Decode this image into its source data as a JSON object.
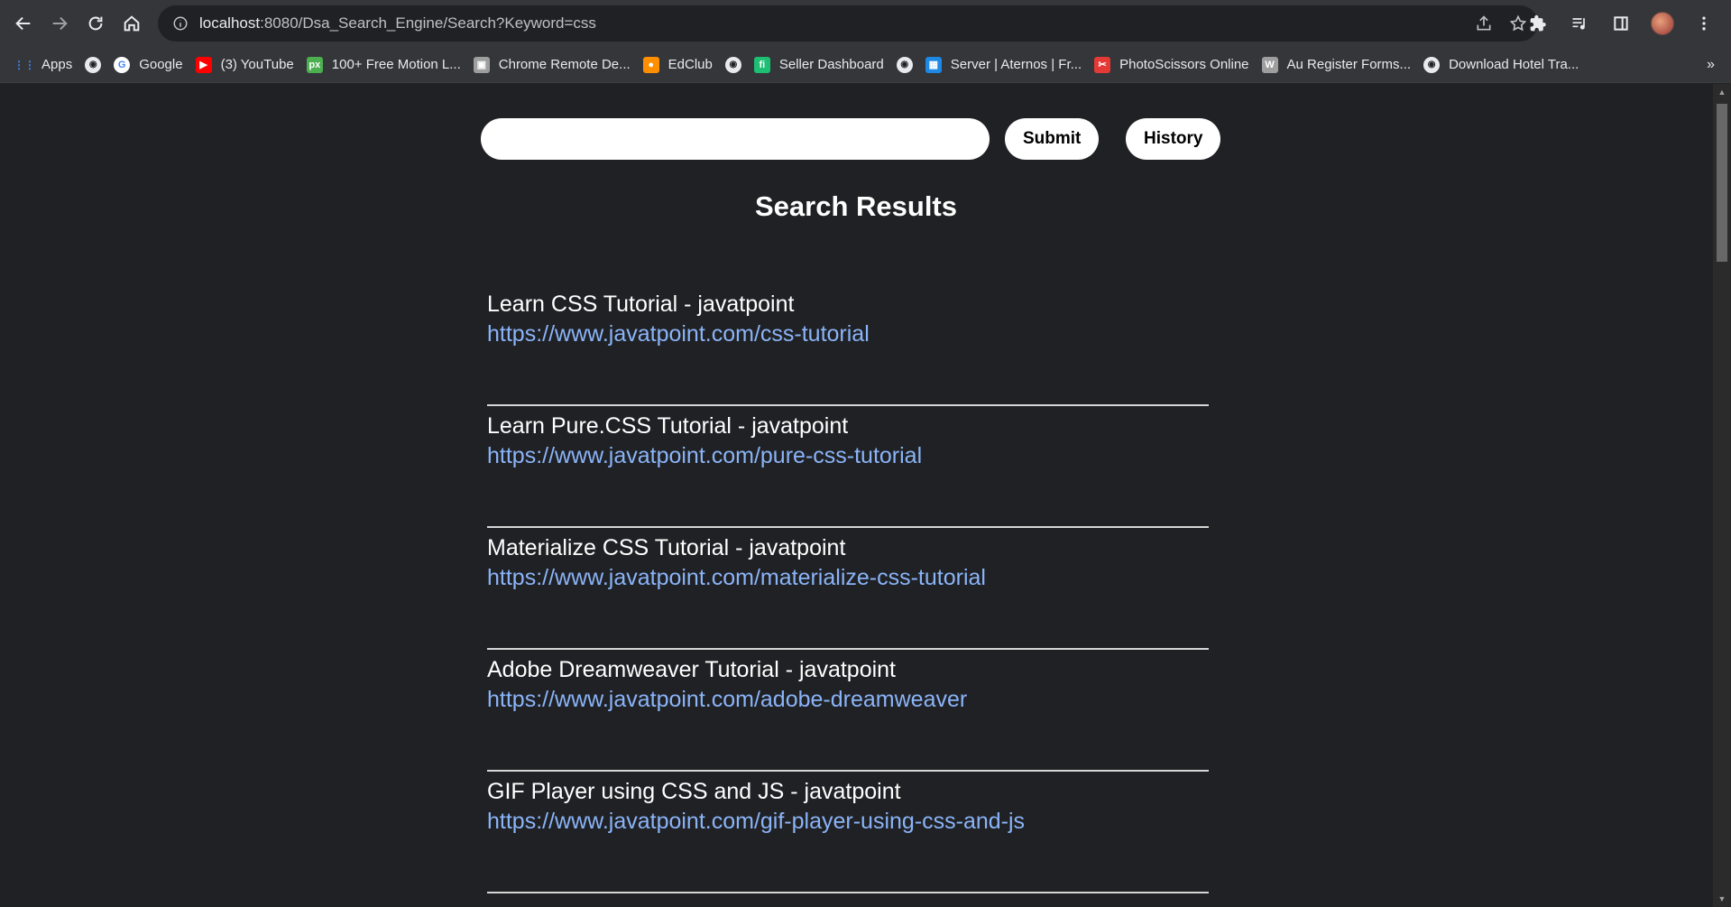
{
  "browser": {
    "url_host": "localhost",
    "url_rest": ":8080/Dsa_Search_Engine/Search?Keyword=css"
  },
  "bookmarks": [
    {
      "label": "Apps",
      "icon": "apps-grid-icon",
      "color": "#4285f4"
    },
    {
      "label": "",
      "icon": "globe-icon",
      "color": "#e8eaed"
    },
    {
      "label": "Google",
      "icon": "google-icon",
      "color": "#ffffff"
    },
    {
      "label": "(3) YouTube",
      "icon": "youtube-icon",
      "color": "#ff0000"
    },
    {
      "label": "100+ Free Motion L...",
      "icon": "px-icon",
      "color": "#4caf50"
    },
    {
      "label": "Chrome Remote De...",
      "icon": "remote-desktop-icon",
      "color": "#9e9e9e"
    },
    {
      "label": "EdClub",
      "icon": "edclub-icon",
      "color": "#ff8f00"
    },
    {
      "label": "",
      "icon": "globe-icon",
      "color": "#e8eaed"
    },
    {
      "label": "Seller Dashboard",
      "icon": "fiverr-icon",
      "color": "#1dbf73"
    },
    {
      "label": "",
      "icon": "globe-icon",
      "color": "#e8eaed"
    },
    {
      "label": "Server | Aternos | Fr...",
      "icon": "aternos-icon",
      "color": "#1e88e5"
    },
    {
      "label": "PhotoScissors Online",
      "icon": "photoscissors-icon",
      "color": "#e53935"
    },
    {
      "label": "Au Register Forms...",
      "icon": "wordpress-icon",
      "color": "#9e9e9e"
    },
    {
      "label": "Download Hotel Tra...",
      "icon": "globe-icon",
      "color": "#e8eaed"
    }
  ],
  "search": {
    "value": "",
    "placeholder": "",
    "submit_label": "Submit",
    "history_label": "History"
  },
  "results_title": "Search Results",
  "results": [
    {
      "title": "Learn CSS Tutorial - javatpoint",
      "url": "https://www.javatpoint.com/css-tutorial"
    },
    {
      "title": "Learn Pure.CSS Tutorial - javatpoint",
      "url": "https://www.javatpoint.com/pure-css-tutorial"
    },
    {
      "title": "Materialize CSS Tutorial - javatpoint",
      "url": "https://www.javatpoint.com/materialize-css-tutorial"
    },
    {
      "title": "Adobe Dreamweaver Tutorial - javatpoint",
      "url": "https://www.javatpoint.com/adobe-dreamweaver"
    },
    {
      "title": "GIF Player using CSS and JS - javatpoint",
      "url": "https://www.javatpoint.com/gif-player-using-css-and-js"
    }
  ],
  "colors": {
    "background": "#202124",
    "link": "#8ab4f8",
    "chrome": "#35363a"
  }
}
